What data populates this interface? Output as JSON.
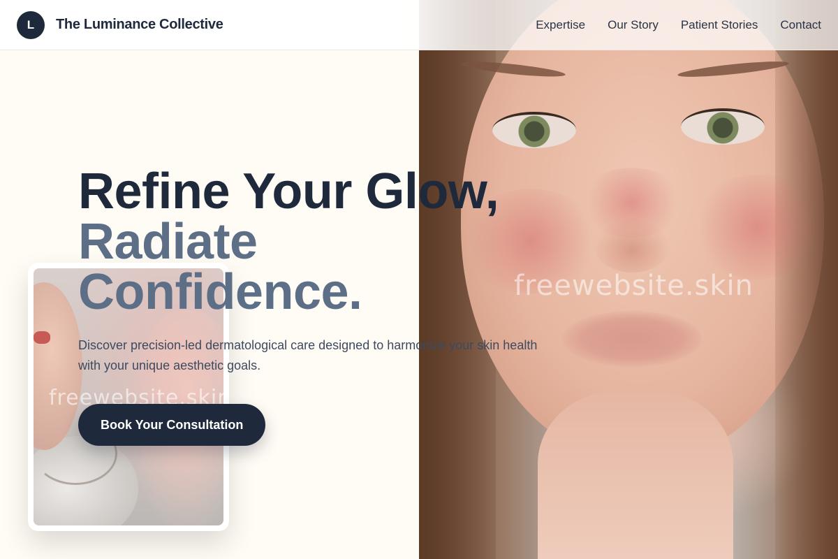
{
  "header": {
    "logo_letter": "L",
    "brand_name": "The Luminance Collective",
    "nav": [
      {
        "label": "Expertise"
      },
      {
        "label": "Our Story"
      },
      {
        "label": "Patient Stories"
      },
      {
        "label": "Contact"
      }
    ]
  },
  "hero": {
    "headline_line1": "Refine Your Glow,",
    "headline_line2": "Radiate",
    "headline_line3": "Confidence.",
    "subtext": "Discover precision-led dermatological care designed to harmonize your skin health with your unique aesthetic goals.",
    "cta_label": "Book Your Consultation",
    "photo_watermark": "freewebsite.skin"
  },
  "side_card": {
    "watermark": "freewebsite.skin"
  },
  "colors": {
    "primary": "#1e293b",
    "secondary_heading": "#5d6e87",
    "background": "#fffbf5"
  }
}
